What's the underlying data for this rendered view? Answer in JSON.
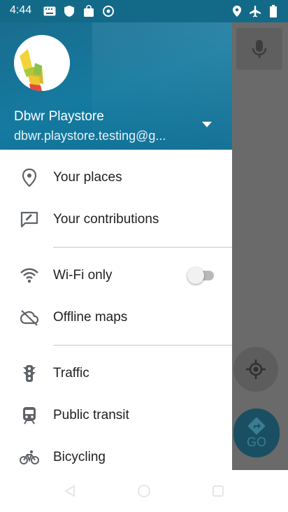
{
  "status_bar": {
    "time": "4:44"
  },
  "account": {
    "name": "Dbwr Playstore",
    "email": "dbwr.playstore.testing@g..."
  },
  "menu": {
    "your_places": "Your places",
    "your_contributions": "Your contributions",
    "wifi_only": "Wi-Fi only",
    "wifi_only_enabled": false,
    "offline_maps": "Offline maps",
    "traffic": "Traffic",
    "public_transit": "Public transit",
    "bicycling": "Bicycling"
  },
  "map": {
    "go_label": "GO"
  },
  "colors": {
    "header": "#136a88",
    "accent": "#1a73e8"
  }
}
